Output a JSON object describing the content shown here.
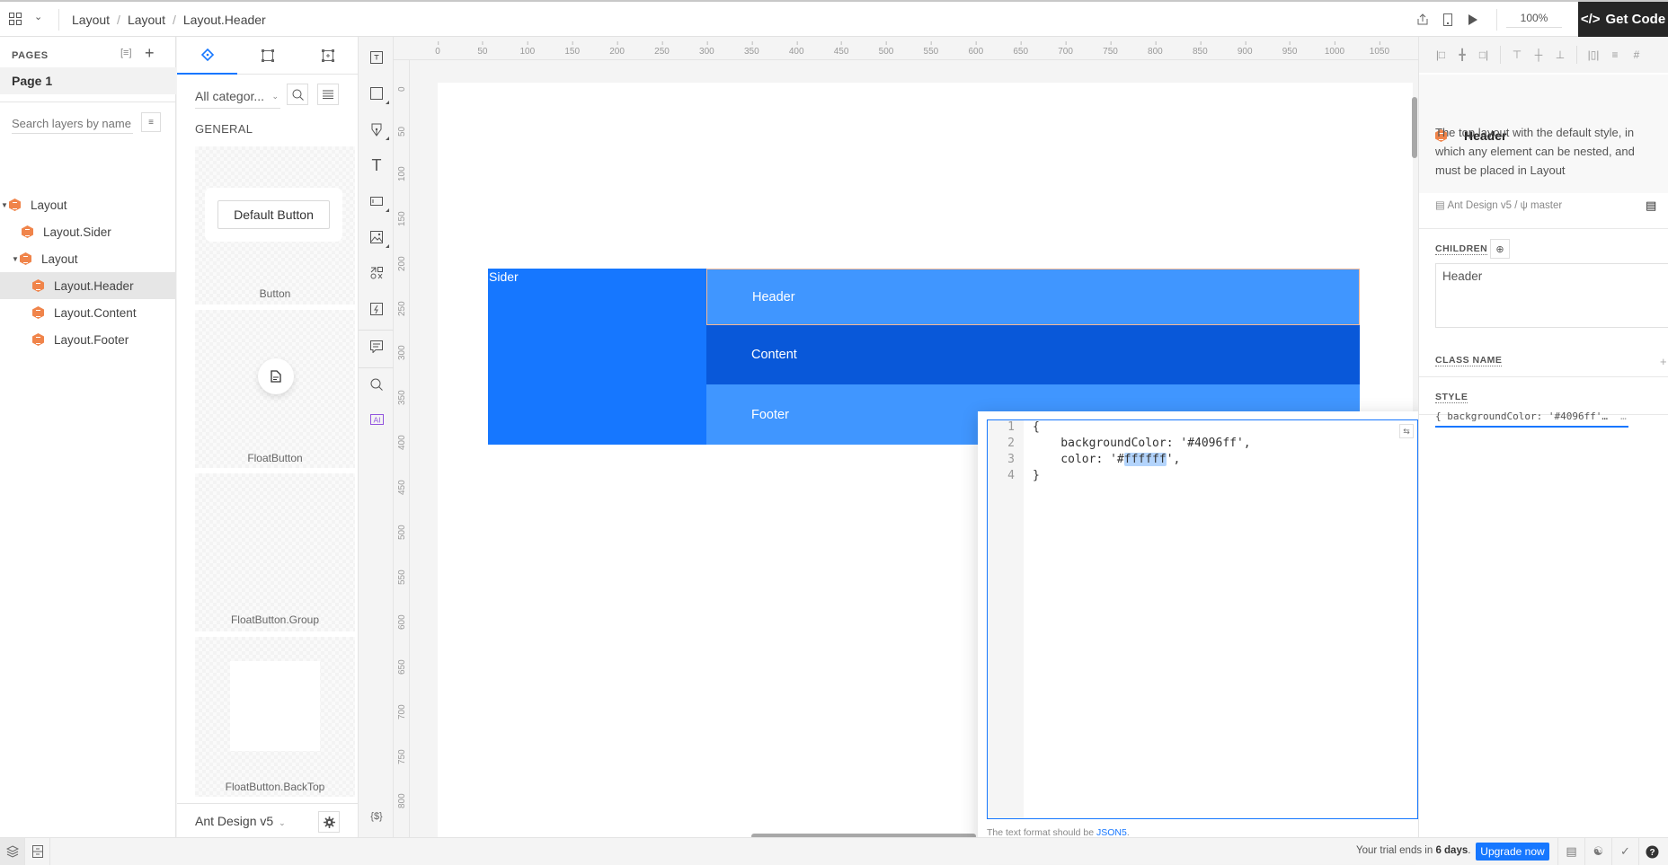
{
  "topbar": {
    "breadcrumb": [
      "Layout",
      "Layout",
      "Layout.Header"
    ],
    "zoom": "100%",
    "get_code_label": "Get Code",
    "icons": [
      "app-grid-icon",
      "chevron-down-icon",
      "export-icon",
      "device-icon",
      "play-icon"
    ]
  },
  "pages": {
    "header": "PAGES",
    "items": [
      {
        "label": "Page 1",
        "selected": true
      }
    ]
  },
  "layers": {
    "search_placeholder": "Search layers by name",
    "tree": [
      {
        "label": "Layout",
        "depth": 0,
        "expanded": true
      },
      {
        "label": "Layout.Sider",
        "depth": 1
      },
      {
        "label": "Layout",
        "depth": 1,
        "expanded": true
      },
      {
        "label": "Layout.Header",
        "depth": 2,
        "selected": true
      },
      {
        "label": "Layout.Content",
        "depth": 2
      },
      {
        "label": "Layout.Footer",
        "depth": 2
      }
    ]
  },
  "components": {
    "category_select": "All categor...",
    "section": "GENERAL",
    "cards": [
      {
        "label": "Button",
        "preview_text": "Default Button"
      },
      {
        "label": "FloatButton"
      },
      {
        "label": "FloatButton.Group"
      },
      {
        "label": "FloatButton.BackTop"
      }
    ],
    "library": "Ant Design v5"
  },
  "tools": [
    "text-frame",
    "rectangle",
    "pen",
    "text",
    "input",
    "image",
    "components",
    "interaction",
    "comment",
    "search",
    "ai"
  ],
  "rulers": {
    "horizontal": [
      0,
      50,
      100,
      150,
      200,
      250,
      300,
      350,
      400,
      450,
      500,
      550,
      600,
      650,
      700,
      750,
      800,
      850,
      900,
      950,
      1000,
      1050
    ],
    "vertical": [
      0,
      50,
      100,
      150,
      200,
      250,
      300,
      350,
      400,
      450,
      500,
      550,
      600,
      650,
      700,
      750,
      800
    ]
  },
  "canvas": {
    "sider": {
      "label": "Sider",
      "color": "#1677ff"
    },
    "header": {
      "label": "Header",
      "color": "#4096ff"
    },
    "content": {
      "label": "Content",
      "color": "#0958d9"
    },
    "footer": {
      "label": "Footer",
      "color": "#4096ff"
    }
  },
  "style_editor": {
    "lines": [
      {
        "n": "1",
        "text": "{"
      },
      {
        "n": "2",
        "text": "    backgroundColor: '#4096ff',"
      },
      {
        "n": "3",
        "pre": "    color: '#",
        "hl": "ffffff",
        "post": "',"
      },
      {
        "n": "4",
        "text": "}"
      }
    ],
    "hint_prefix": "The text format should be ",
    "hint_link": "JSON5",
    "hint_suffix": "."
  },
  "inspector": {
    "title": "Header",
    "description": "The top layout with the default style, in which any element can be nested, and must be placed in Layout",
    "library": "Ant Design v5",
    "branch": "master",
    "children_label": "CHILDREN",
    "children_value": "Header",
    "classname_label": "CLASS NAME",
    "style_label": "STYLE",
    "style_value": "{ backgroundColor: '#4096ff'…",
    "more": "…"
  },
  "statusbar": {
    "trial_prefix": "Your trial ends in ",
    "trial_days": "6 days",
    "trial_suffix": ".",
    "upgrade_label": "Upgrade now"
  }
}
